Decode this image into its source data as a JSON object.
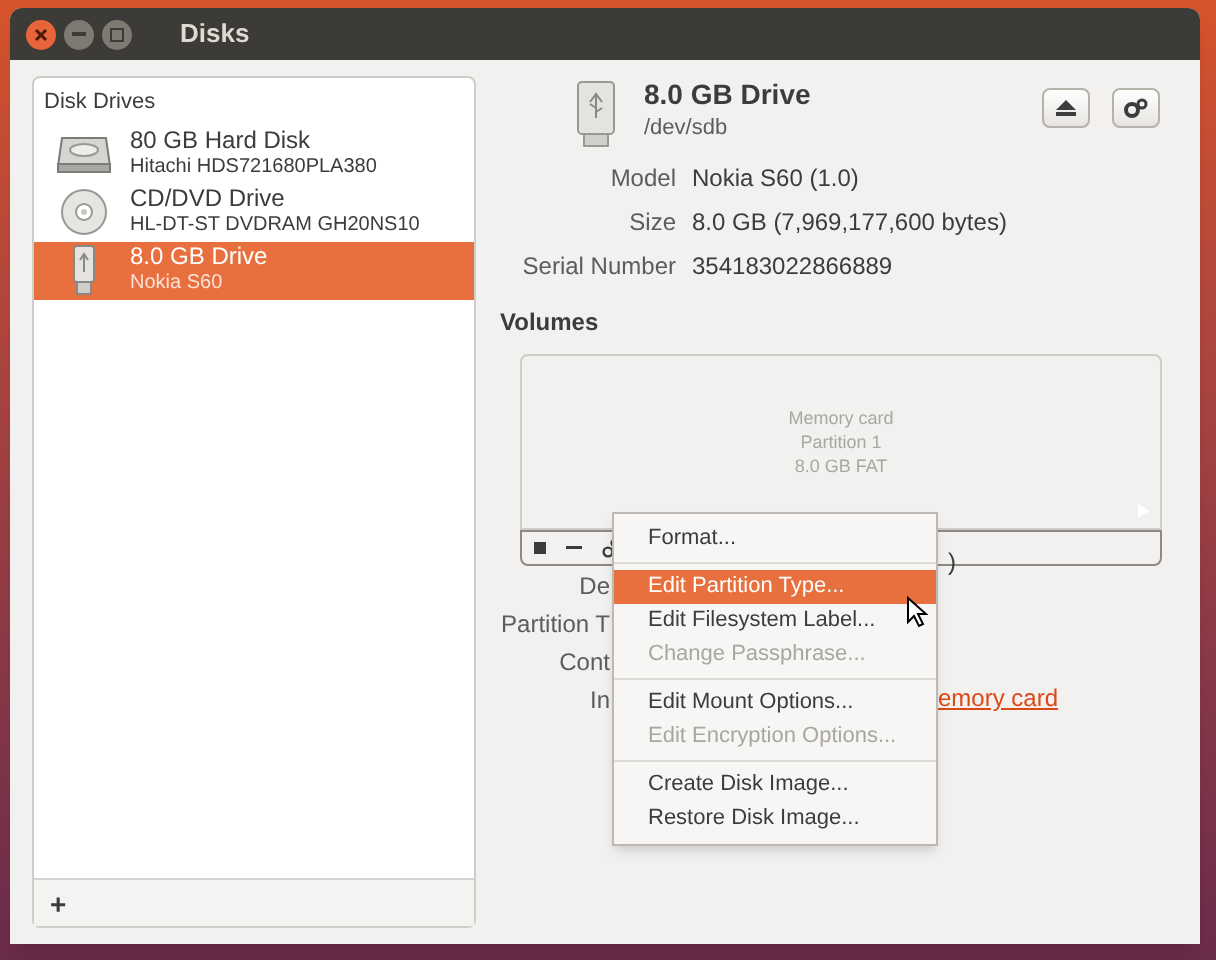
{
  "window": {
    "title": "Disks"
  },
  "sidebar": {
    "heading": "Disk Drives",
    "items": [
      {
        "kind": "harddisk",
        "name": "80 GB Hard Disk",
        "model": "Hitachi HDS721680PLA380",
        "selected": false
      },
      {
        "kind": "optical",
        "name": "CD/DVD Drive",
        "model": "HL-DT-ST DVDRAM GH20NS10",
        "selected": false
      },
      {
        "kind": "usb",
        "name": "8.0 GB Drive",
        "model": "Nokia S60",
        "selected": true
      }
    ],
    "add_button": "+"
  },
  "drive": {
    "title": "8.0 GB Drive",
    "device": "/dev/sdb",
    "fields": [
      {
        "label": "Model",
        "value": "Nokia S60 (1.0)"
      },
      {
        "label": "Size",
        "value": "8.0 GB (7,969,177,600 bytes)"
      },
      {
        "label": "Serial Number",
        "value": "354183022866889"
      }
    ]
  },
  "volumes": {
    "heading": "Volumes",
    "partition": [
      "Memory card",
      "Partition 1",
      "8.0 GB FAT"
    ]
  },
  "partition_info": {
    "size_tail": ")",
    "labels": [
      "De",
      "Partition T",
      "Cont",
      "In"
    ],
    "link": "emory card"
  },
  "menu": [
    {
      "label": "Format...",
      "selected": false,
      "disabled": false
    },
    {
      "kind": "separator"
    },
    {
      "label": "Edit Partition Type...",
      "selected": true,
      "disabled": false
    },
    {
      "label": "Edit Filesystem Label...",
      "selected": false,
      "disabled": false
    },
    {
      "label": "Change Passphrase...",
      "selected": false,
      "disabled": true
    },
    {
      "kind": "separator"
    },
    {
      "label": "Edit Mount Options...",
      "selected": false,
      "disabled": false
    },
    {
      "label": "Edit Encryption Options...",
      "selected": false,
      "disabled": true
    },
    {
      "kind": "separator"
    },
    {
      "label": "Create Disk Image...",
      "selected": false,
      "disabled": false
    },
    {
      "label": "Restore Disk Image...",
      "selected": false,
      "disabled": false
    }
  ]
}
